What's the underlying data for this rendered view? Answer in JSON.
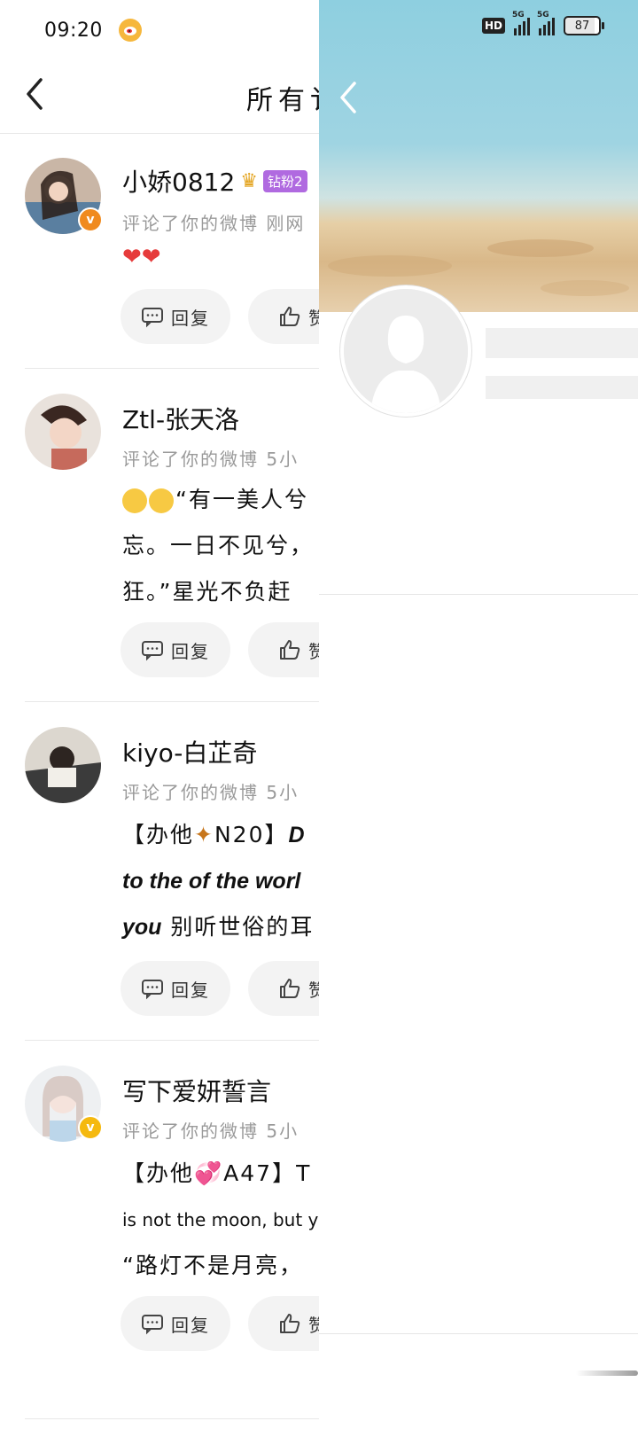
{
  "status": {
    "time": "09:20",
    "battery": "87",
    "hd": "HD",
    "net1": "5G",
    "net2": "5G"
  },
  "nav": {
    "title": "所有讠"
  },
  "comments": [
    {
      "name": "小娇0812",
      "badge": "钻粉2",
      "meta": "评论了你的微博  刚网",
      "lines": [
        "❤❤"
      ],
      "reply": "回复",
      "like": "赞"
    },
    {
      "name": "Ztl-张天洛",
      "meta": "评论了你的微博  5小",
      "lines": [
        "“有一美人兮",
        "忘。一日不见兮，",
        "狂。”星光不负赶"
      ],
      "reply": "回复",
      "like": "赞"
    },
    {
      "name": "kiyo-白芷奇",
      "meta": "评论了你的微博  5小",
      "lines": [
        "【办他",
        "N20】",
        "D",
        "to the of the worl",
        "you",
        " 别听世俗的耳"
      ],
      "reply": "回复",
      "like": "赞"
    },
    {
      "name": "写下爱妍誓言",
      "meta": "评论了你的微博  5小",
      "lines": [
        "【办他",
        "A47】",
        "T",
        "is not the moon, but y",
        "“路灯不是月亮，"
      ],
      "reply": "回复",
      "like": "赞"
    }
  ],
  "colors": {
    "accent_orange": "#f08a1e",
    "accent_yellow": "#f5b90f",
    "fan_purple": "#b06ae0"
  }
}
